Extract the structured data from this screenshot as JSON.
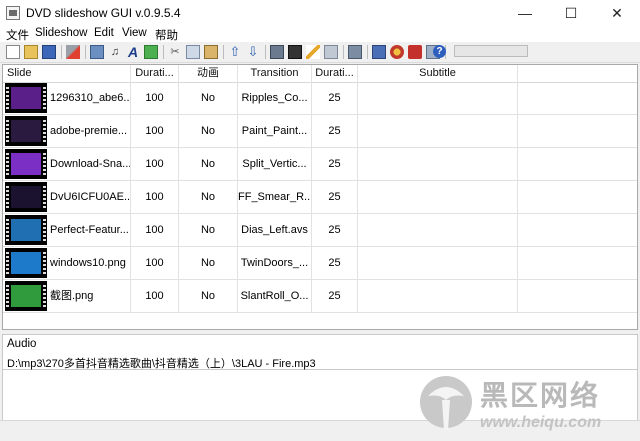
{
  "window": {
    "title": "DVD slideshow GUI v.0.9.5.4",
    "minimize_glyph": "—",
    "maximize_glyph": "☐",
    "close_glyph": "✕"
  },
  "menu": [
    "文件",
    "Slideshow",
    "Edit",
    "View",
    "帮助"
  ],
  "table": {
    "columns": [
      "Slide",
      "Durati...",
      "动画",
      "Transition",
      "Durati...",
      "Subtitle"
    ],
    "rows": [
      {
        "slide": "1296310_abe6...",
        "duration": "100",
        "anim": "No",
        "transition": "Ripples_Co...",
        "tduration": "25",
        "subtitle": "",
        "thumb_color": "#5b1f8a"
      },
      {
        "slide": "adobe-premie...",
        "duration": "100",
        "anim": "No",
        "transition": "Paint_Paint...",
        "tduration": "25",
        "subtitle": "",
        "thumb_color": "#2a1a3f"
      },
      {
        "slide": "Download-Sna...",
        "duration": "100",
        "anim": "No",
        "transition": "Split_Vertic...",
        "tduration": "25",
        "subtitle": "",
        "thumb_color": "#7b2fc4"
      },
      {
        "slide": "DvU6ICFU0AE...",
        "duration": "100",
        "anim": "No",
        "transition": "FF_Smear_R...",
        "tduration": "25",
        "subtitle": "",
        "thumb_color": "#1b1230"
      },
      {
        "slide": "Perfect-Featur...",
        "duration": "100",
        "anim": "No",
        "transition": "Dias_Left.avs",
        "tduration": "25",
        "subtitle": "",
        "thumb_color": "#1f6fb2"
      },
      {
        "slide": "windows10.png",
        "duration": "100",
        "anim": "No",
        "transition": "TwinDoors_...",
        "tduration": "25",
        "subtitle": "",
        "thumb_color": "#1d79c9"
      },
      {
        "slide": "截图.png",
        "duration": "100",
        "anim": "No",
        "transition": "SlantRoll_O...",
        "tduration": "25",
        "subtitle": "",
        "thumb_color": "#2f9b3c"
      }
    ]
  },
  "audio": {
    "label": "Audio",
    "path": "D:\\mp3\\270多首抖音精选歌曲\\抖音精选（上）\\3LAU - Fire.mp3"
  },
  "watermark": {
    "text": "黑区网络",
    "url": "www.heiqu.com"
  },
  "colors": {
    "selection": "#0078d7",
    "grid_border": "#a9a9a9"
  }
}
